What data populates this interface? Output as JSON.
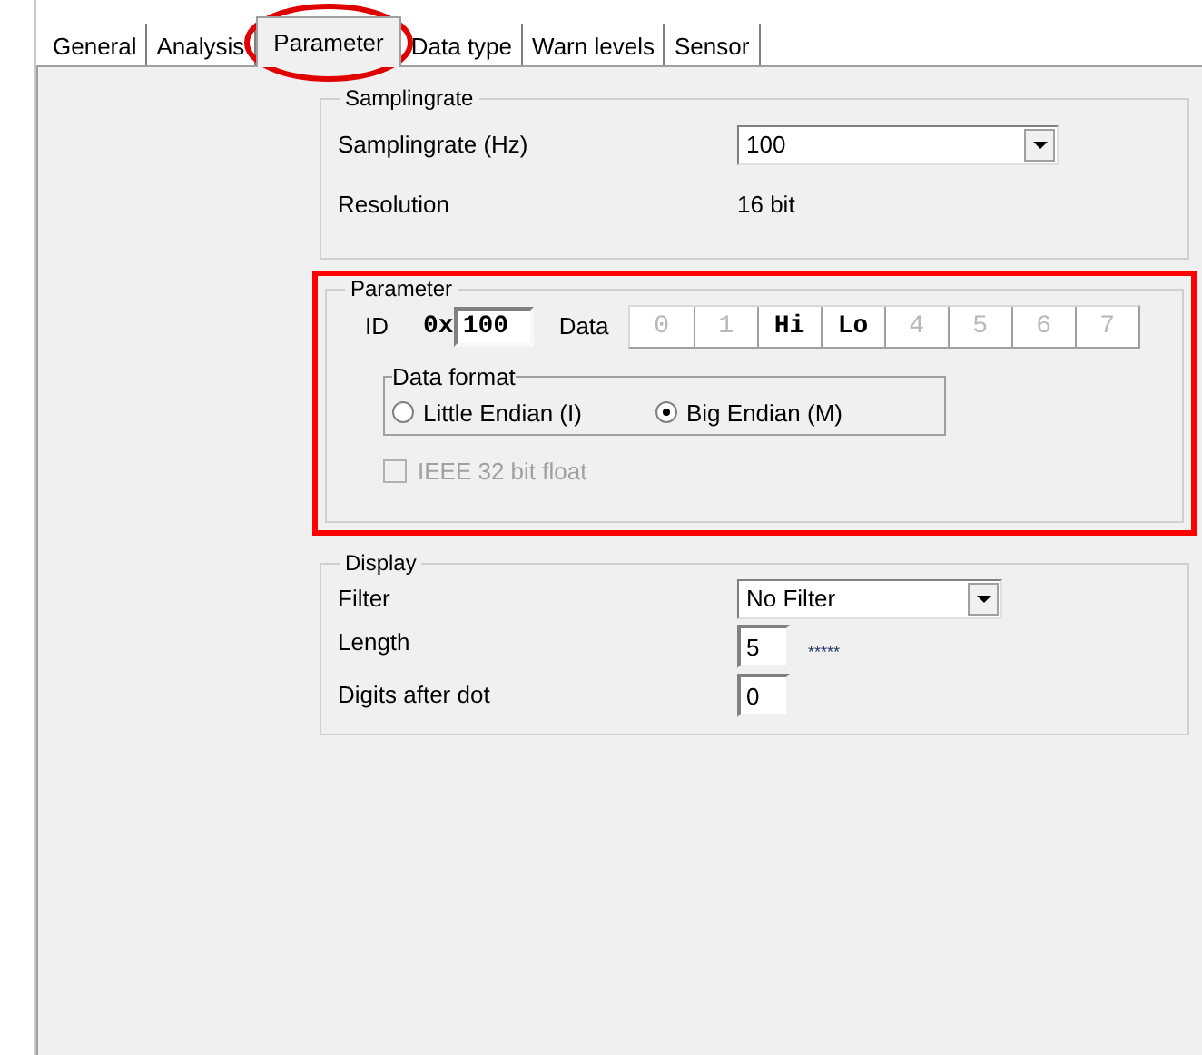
{
  "tabs": [
    {
      "label": "General",
      "selected": false
    },
    {
      "label": "Analysis",
      "selected": false
    },
    {
      "label": "Parameter",
      "selected": true
    },
    {
      "label": "Data type",
      "selected": false
    },
    {
      "label": "Warn levels",
      "selected": false
    },
    {
      "label": "Sensor",
      "selected": false
    }
  ],
  "samplingrate": {
    "title": "Samplingrate",
    "rate_label": "Samplingrate (Hz)",
    "rate_value": "100",
    "resolution_label": "Resolution",
    "resolution_value": "16 bit"
  },
  "parameter": {
    "title": "Parameter",
    "highlighted": true,
    "id_label": "ID",
    "id_prefix": "0x",
    "id_value": "100",
    "data_label": "Data",
    "bytes": [
      {
        "label": "0",
        "active": false
      },
      {
        "label": "1",
        "active": false
      },
      {
        "label": "Hi",
        "active": true
      },
      {
        "label": "Lo",
        "active": true
      },
      {
        "label": "4",
        "active": false
      },
      {
        "label": "5",
        "active": false
      },
      {
        "label": "6",
        "active": false
      },
      {
        "label": "7",
        "active": false
      }
    ],
    "data_format": {
      "title": "Data format",
      "options": [
        {
          "label": "Little Endian (I)",
          "selected": false
        },
        {
          "label": "Big Endian (M)",
          "selected": true
        }
      ]
    },
    "float": {
      "label": "IEEE 32 bit float",
      "checked": false,
      "disabled": true
    }
  },
  "display": {
    "title": "Display",
    "filter_label": "Filter",
    "filter_value": "No Filter",
    "length_label": "Length",
    "length_value": "5",
    "length_preview": "*****",
    "digits_label": "Digits after dot",
    "digits_value": "0"
  }
}
